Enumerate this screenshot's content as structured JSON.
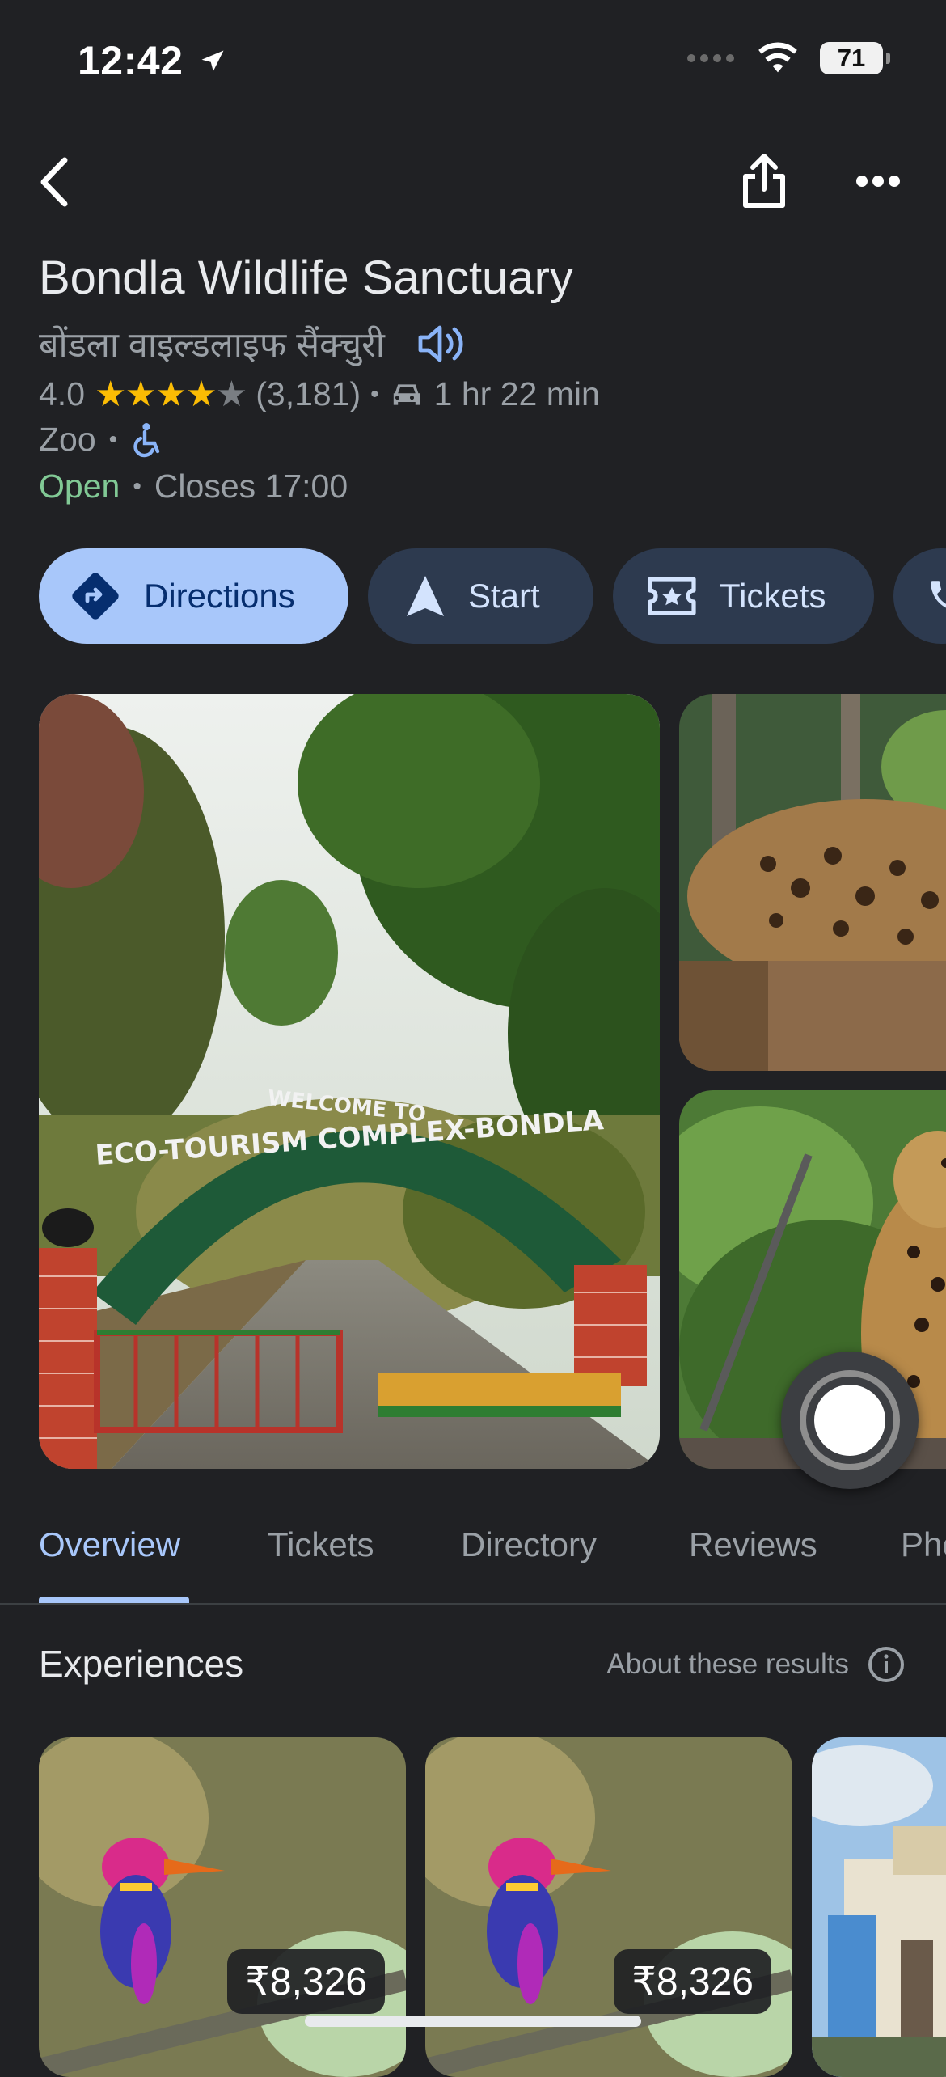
{
  "status_bar": {
    "time": "12:42",
    "battery": "71"
  },
  "place": {
    "name": "Bondla Wildlife Sanctuary",
    "local_name": "बोंडला वाइल्डलाइफ सैंक्चुरी",
    "rating": "4.0",
    "stars_filled": 4,
    "review_count": "(3,181)",
    "drive_time": "1 hr 22 min",
    "category": "Zoo",
    "open_status": "Open",
    "closing": "Closes 17:00"
  },
  "actions": {
    "directions": "Directions",
    "start": "Start",
    "tickets": "Tickets"
  },
  "tabs": [
    "Overview",
    "Tickets",
    "Directory",
    "Reviews",
    "Pho"
  ],
  "experiences": {
    "title": "Experiences",
    "about": "About these results",
    "cards": [
      {
        "price": "₹8,326"
      },
      {
        "price": "₹8,326"
      }
    ]
  },
  "photos": {
    "arch_sign_line1": "WELCOME TO",
    "arch_sign_line2": "ECO-TOURISM COMPLEX-BONDLA"
  },
  "colors": {
    "background": "#202124",
    "accent": "#a8c7fa",
    "open": "#81c995",
    "star": "#fbbc04"
  },
  "icons": [
    "back-arrow-icon",
    "share-icon",
    "more-icon",
    "speaker-icon",
    "car-icon",
    "wheelchair-icon",
    "directions-icon",
    "navigation-icon",
    "ticket-icon",
    "phone-icon",
    "camera-icon",
    "info-icon"
  ]
}
